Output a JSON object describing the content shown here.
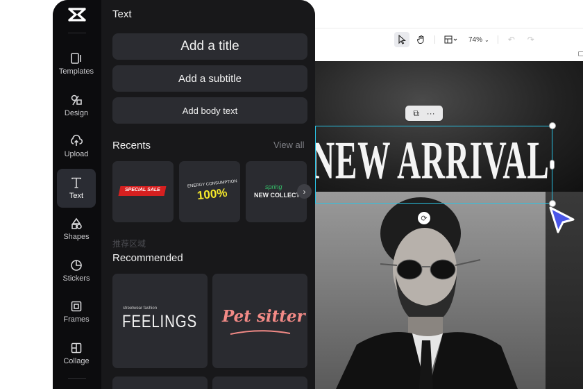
{
  "canvas": {
    "zoom": "74%",
    "headline": "NEW ARRIVAL",
    "float_bar": {
      "copy_icon": "copy-icon",
      "more": "···"
    },
    "accent_color": "#29c4e6"
  },
  "sidebar": {
    "items": [
      {
        "label": "Templates",
        "icon": "templates-icon"
      },
      {
        "label": "Design",
        "icon": "design-icon"
      },
      {
        "label": "Upload",
        "icon": "upload-icon"
      },
      {
        "label": "Text",
        "icon": "text-icon",
        "active": true
      },
      {
        "label": "Shapes",
        "icon": "shapes-icon"
      },
      {
        "label": "Stickers",
        "icon": "stickers-icon"
      },
      {
        "label": "Frames",
        "icon": "frames-icon"
      },
      {
        "label": "Collage",
        "icon": "collage-icon"
      }
    ]
  },
  "panel": {
    "title": "Text",
    "add_title": "Add a title",
    "add_subtitle": "Add a subtitle",
    "add_body": "Add body text",
    "recents_label": "Recents",
    "view_all": "View all",
    "recents": [
      {
        "text": "SPECIAL SALE"
      },
      {
        "small": "ENERGY CONSUMPTION",
        "big": "100%"
      },
      {
        "small": "spring",
        "big": "NEW COLLECTION"
      }
    ],
    "faded_label": "推荐区域",
    "recommended_label": "Recommended",
    "recommended": [
      {
        "small": "streetwear fashion",
        "big": "FEELINGS"
      },
      {
        "big": "Pet sitter"
      }
    ]
  }
}
